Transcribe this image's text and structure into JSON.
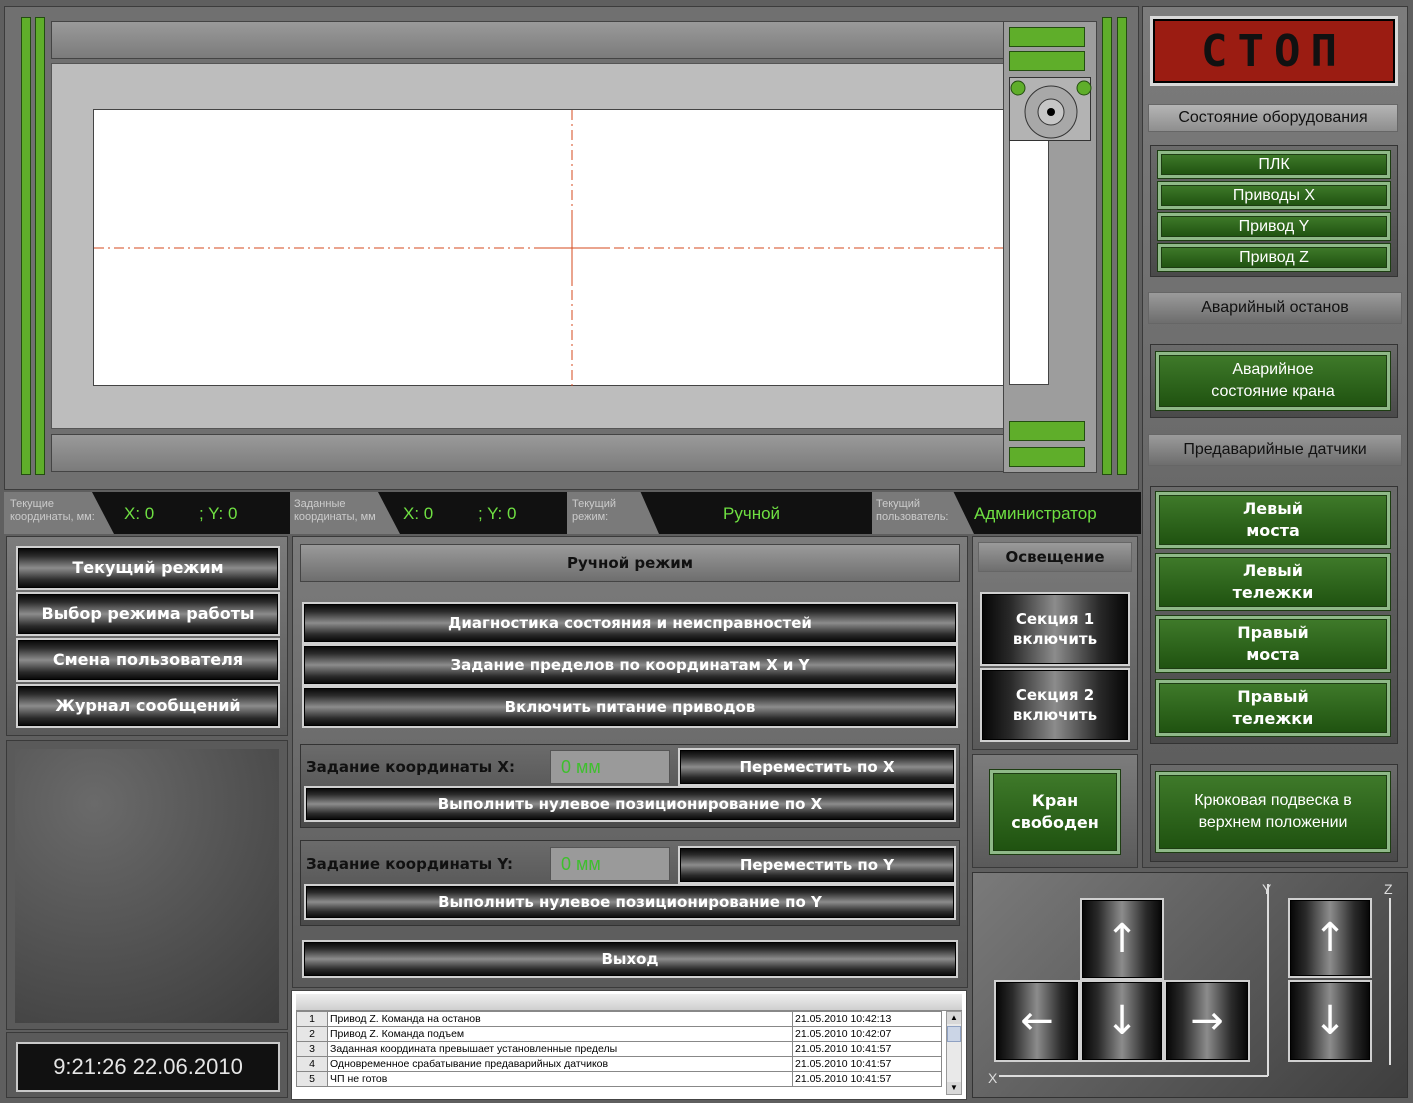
{
  "stop": "СТОП",
  "equipment": {
    "title": "Состояние оборудования",
    "items": [
      "ПЛК",
      "Приводы X",
      "Привод Y",
      "Привод Z"
    ]
  },
  "emergency": {
    "title": "Аварийный останов",
    "crane_state": "Аварийное состояние крана"
  },
  "preemergency": {
    "title": "Предаварийные датчики",
    "items": [
      "Левый моста",
      "Левый тележки",
      "Правый моста",
      "Правый тележки"
    ]
  },
  "hook": "Крюковая подвеска в верхнем положении",
  "crane_free": "Кран свободен",
  "status": {
    "current_coords_label": "Текущие координаты, мм:",
    "current_x": "X: 0",
    "current_y": "; Y: 0",
    "target_coords_label": "Заданные координаты, мм",
    "target_x": "X: 0",
    "target_y": "; Y: 0",
    "mode_label": "Текущий режим:",
    "mode_value": "Ручной",
    "user_label": "Текущий пользователь:",
    "user_value": "Администратор"
  },
  "left_menu": [
    "Текущий режим",
    "Выбор режима работы",
    "Смена пользователя",
    "Журнал сообщений"
  ],
  "clock": "9:21:26 22.06.2010",
  "manual_mode": {
    "title": "Ручной режим",
    "diagnostics": "Диагностика состояния и неисправностей",
    "limits": "Задание пределов по координатам X и Y",
    "power": "Включить питание приводов",
    "set_x_label": "Задание координаты X:",
    "set_x_value": "0 мм",
    "move_x": "Переместить по X",
    "zero_x": "Выполнить нулевое позиционирование по X",
    "set_y_label": "Задание координаты Y:",
    "set_y_value": "0 мм",
    "move_y": "Переместить по Y",
    "zero_y": "Выполнить нулевое позиционирование по Y",
    "exit": "Выход"
  },
  "lighting": {
    "title": "Освещение",
    "section1": "Секция 1 включить",
    "section2": "Секция 2 включить"
  },
  "jog": {
    "y_axis": "Y",
    "x_axis": "X",
    "z_axis": "Z",
    "up": "↑",
    "down": "↓",
    "left": "←",
    "right": "→"
  },
  "log": [
    {
      "n": "1",
      "msg": "Привод Z. Команда на останов",
      "time": "21.05.2010 10:42:13"
    },
    {
      "n": "2",
      "msg": "Привод Z. Команда подъем",
      "time": "21.05.2010 10:42:07"
    },
    {
      "n": "3",
      "msg": "Заданная координата превышает установленные пределы",
      "time": "21.05.2010 10:41:57"
    },
    {
      "n": "4",
      "msg": "Одновременное срабатывание предаварийных датчиков",
      "time": "21.05.2010 10:41:57"
    },
    {
      "n": "5",
      "msg": "ЧП не готов",
      "time": "21.05.2010 10:41:57"
    }
  ],
  "colors": {
    "accent_green": "#6fe042",
    "stop_red": "#9b1c12"
  }
}
